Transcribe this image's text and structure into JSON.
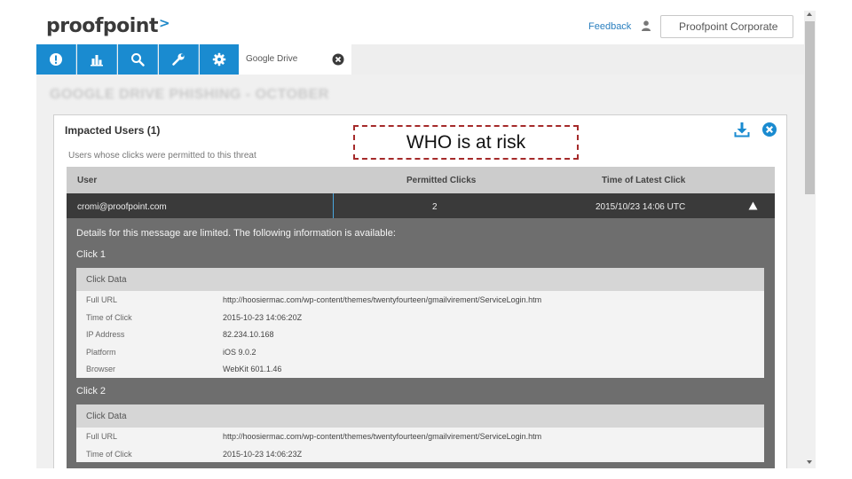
{
  "header": {
    "logo_text": "proofpoint",
    "logo_mark": ">",
    "feedback_label": "Feedback",
    "org_name": "Proofpoint Corporate"
  },
  "nav": {
    "icons": [
      "alert-icon",
      "bar-chart-icon",
      "search-icon",
      "wrench-icon",
      "gear-icon"
    ],
    "tab_label": "Google Drive",
    "accent_color": "#1a8bd0"
  },
  "page": {
    "title": "GOOGLE DRIVE PHISHING - OCTOBER"
  },
  "panel": {
    "title": "Impacted Users (1)",
    "subtitle": "Users whose clicks were permitted to this threat",
    "columns": [
      "User",
      "Permitted Clicks",
      "Time of Latest Click"
    ],
    "rows": [
      {
        "user": "cromi@proofpoint.com",
        "clicks": "2",
        "time": "2015/10/23 14:06 UTC"
      }
    ],
    "details_note": "Details for this message are limited. The following information is available:",
    "clicks": [
      {
        "label": "Click 1",
        "card_title": "Click Data",
        "fields": [
          {
            "key": "Full URL",
            "value": "http://hoosiermac.com/wp-content/themes/twentyfourteen/gmailvirement/ServiceLogin.htm"
          },
          {
            "key": "Time of Click",
            "value": "2015-10-23 14:06:20Z"
          },
          {
            "key": "IP Address",
            "value": "82.234.10.168"
          },
          {
            "key": "Platform",
            "value": "iOS 9.0.2"
          },
          {
            "key": "Browser",
            "value": "WebKit 601.1.46"
          }
        ]
      },
      {
        "label": "Click 2",
        "card_title": "Click Data",
        "fields": [
          {
            "key": "Full URL",
            "value": "http://hoosiermac.com/wp-content/themes/twentyfourteen/gmailvirement/ServiceLogin.htm"
          },
          {
            "key": "Time of Click",
            "value": "2015-10-23 14:06:23Z"
          }
        ]
      }
    ]
  },
  "annotation": {
    "text": "WHO is at risk",
    "border_color": "#a52a2a"
  }
}
